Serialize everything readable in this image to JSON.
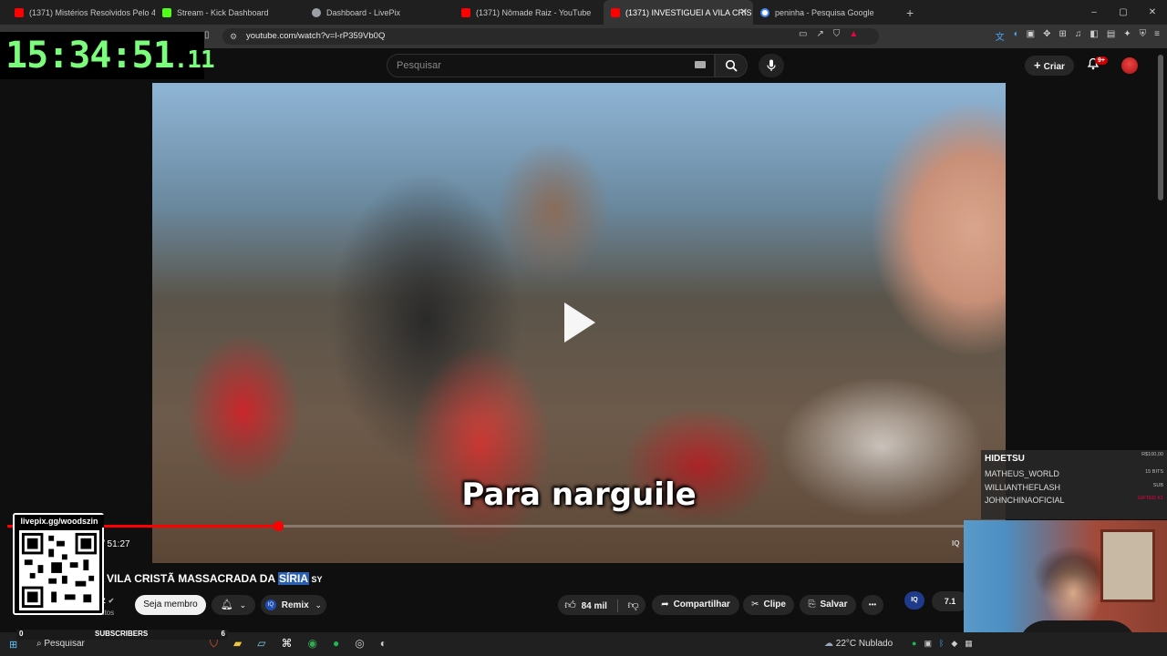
{
  "browser": {
    "tabs": [
      {
        "title": "(1371) Mistérios Resolvidos Pelo 4CH",
        "icon": "youtube-icon",
        "color": "#ff0000"
      },
      {
        "title": "Stream - Kick Dashboard",
        "icon": "kick-icon",
        "color": "#53fc18"
      },
      {
        "title": "Dashboard - LivePix",
        "icon": "globe-icon",
        "color": "#9aa0a6"
      },
      {
        "title": "(1371) Nômade Raiz - YouTube",
        "icon": "youtube-icon",
        "color": "#ff0000"
      },
      {
        "title": "(1371) INVESTIGUEI A VILA CRIS",
        "icon": "youtube-icon",
        "color": "#ff0000",
        "active": true
      },
      {
        "title": "peninha - Pesquisa Google",
        "icon": "google-icon",
        "color": "#4285f4"
      }
    ],
    "new_tab": "+",
    "url": "youtube.com/watch?v=l-rP359Vb0Q",
    "window_controls": [
      "–",
      "▢",
      "✕"
    ]
  },
  "clock": {
    "main": "15:34:51",
    "ms": ".11"
  },
  "youtube": {
    "search_placeholder": "Pesquisar",
    "create_label": "Criar",
    "notif_count": "9+"
  },
  "video": {
    "subtitle": "Para narguile",
    "time": "/ 51:27",
    "iq_small": "IQ",
    "progress_fraction": 0.235
  },
  "info": {
    "title_main": "VILA CRISTÃ MASSACRADA DA ",
    "title_highlight": "SÍRIA",
    "title_suffix": " SY",
    "channel_name": "iz",
    "channel_subs": "Ver mil de inscritos",
    "member_button": "Seja membro",
    "remix_label": "Remix",
    "likes": "84 mil",
    "share_label": "Compartilhar",
    "clip_label": "Clipe",
    "save_label": "Salvar",
    "more_label": "•••",
    "iq_badge": "IQ",
    "partial_next": "7.1"
  },
  "overlays": {
    "qr_label": "livepix.gg/woodszin",
    "alerts": {
      "header": "HIDETSU",
      "header_value": "R$100,00",
      "rows": [
        {
          "name": "MATHEUS_WORLD",
          "value": "15 BITS"
        },
        {
          "name": "WILLIANTHEFLASH",
          "value": "SUB"
        },
        {
          "name": "JOHNCHINAOFICIAL",
          "value": "GIFTED X1"
        }
      ]
    },
    "subscribers": {
      "label": "SUBSCRIBERS",
      "left": "0",
      "right": "6"
    }
  },
  "taskbar": {
    "search": "Pesquisar",
    "weather": "22°C  Nublado"
  },
  "colors": {
    "yt_red": "#ff0000",
    "clock_green": "#7cfc7c",
    "highlight": "#2a5fb4"
  }
}
